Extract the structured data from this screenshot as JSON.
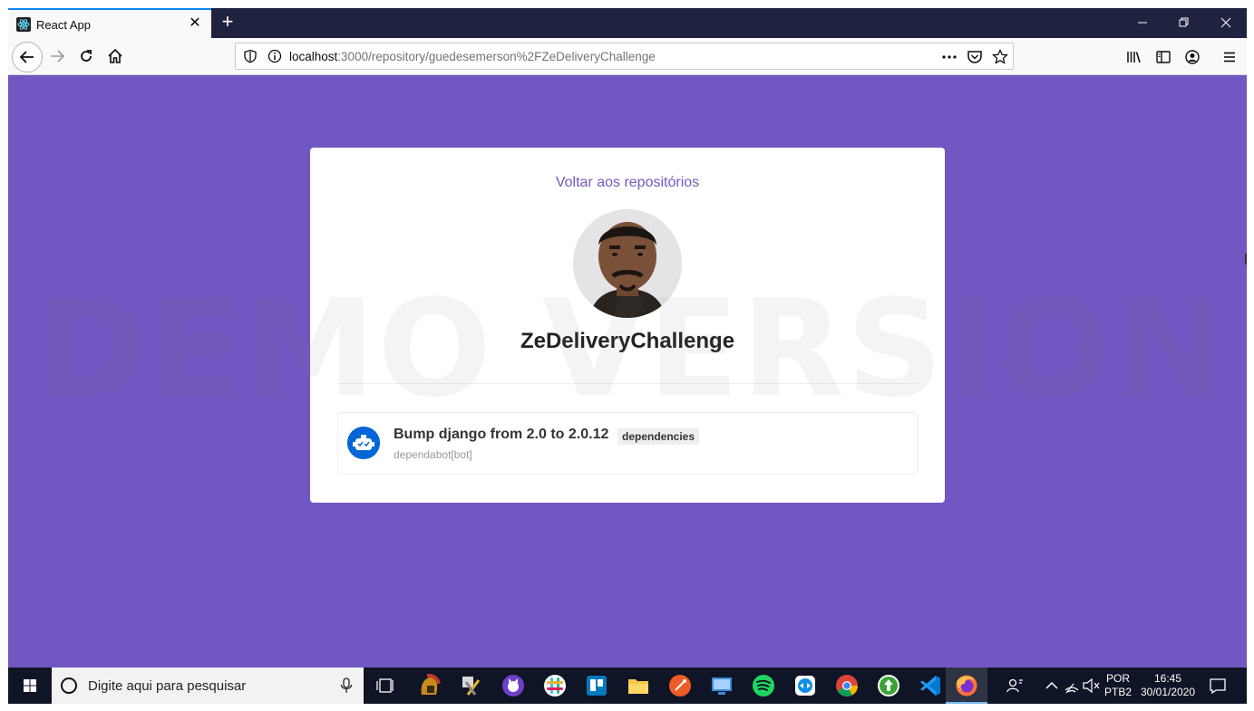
{
  "browser": {
    "tab_title": "React App",
    "url_host": "localhost",
    "url_path": ":3000/repository/guedesemerson%2FZeDeliveryChallenge"
  },
  "page": {
    "back_link": "Voltar aos repositórios",
    "repo_name": "ZeDeliveryChallenge",
    "watermark": "DEMO VERSION",
    "issues": [
      {
        "title": "Bump django from 2.0 to 2.0.12",
        "label": "dependencies",
        "author": "dependabot[bot]"
      }
    ]
  },
  "taskbar": {
    "search_placeholder": "Digite aqui para pesquisar",
    "lang_top": "POR",
    "lang_bottom": "PTB2",
    "time": "16:45",
    "date": "30/01/2020"
  },
  "colors": {
    "page_background": "#7157c2",
    "accent": "#7159c1",
    "tab_strip": "#202340",
    "taskbar": "#0f1526"
  }
}
